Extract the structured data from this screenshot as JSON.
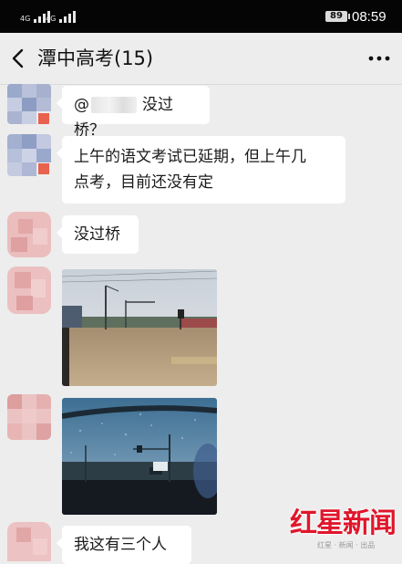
{
  "status_bar": {
    "signal_1": "4G",
    "signal_2": "4G",
    "battery": "89",
    "time": "08:59"
  },
  "header": {
    "title": "潭中高考(15)",
    "back_icon": "chevron-left-icon",
    "more_icon": "more-dots-icon"
  },
  "messages": [
    {
      "type": "text",
      "prefix": "@",
      "text": "没过桥？"
    },
    {
      "type": "text",
      "line1": "上午的语文考试已延期，但上午几",
      "line2": "点考，目前还没有定"
    },
    {
      "type": "text",
      "text": "没过桥"
    },
    {
      "type": "image",
      "description": "flooded road photo"
    },
    {
      "type": "image",
      "description": "rain on windshield photo"
    },
    {
      "type": "text",
      "text": "我这有三个人"
    }
  ],
  "watermark": {
    "name": "红星新闻",
    "sub": "红星 · 新闻 · 出品"
  },
  "colors": {
    "background": "#ededed",
    "bubble": "#ffffff",
    "status_bar": "#050505",
    "watermark": "#e0162b"
  }
}
